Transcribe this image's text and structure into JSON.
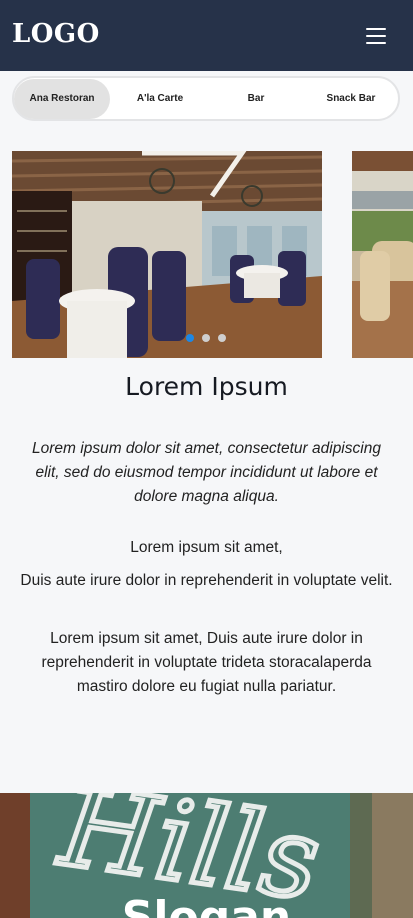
{
  "header": {
    "logo": "LOGO",
    "menu_icon": "hamburger-menu-icon"
  },
  "tabs": [
    {
      "label": "Ana Restoran",
      "active": true
    },
    {
      "label": "A'la Carte",
      "active": false
    },
    {
      "label": "Bar",
      "active": false
    },
    {
      "label": "Snack Bar",
      "active": false
    }
  ],
  "carousel": {
    "slides": [
      "restaurant-dining-room-photo",
      "terrace-chairs-photo"
    ],
    "slide_count": 3,
    "active_slide": 1,
    "active_dot_color": "#1e88e5",
    "inactive_dot_color": "#cfcfcf"
  },
  "content": {
    "title": "Lorem Ipsum",
    "lead": "Lorem ipsum dolor sit amet, consectetur adipiscing elit, sed do eiusmod tempor incididunt ut labore et dolore magna aliqua.",
    "paragraphs": [
      "Lorem ipsum sit amet,",
      "Duis aute irure dolor in reprehenderit in voluptate velit.",
      "Lorem ipsum sit amet, Duis aute irure dolor in reprehenderit in voluptate trideta storacalaperda mastiro dolore eu fugiat nulla pariatur."
    ]
  },
  "hero": {
    "image": "hills-signage-photo",
    "sign_text": "Hills",
    "slogan": "Slogan"
  },
  "colors": {
    "header_bg": "#263249",
    "page_bg": "#f6f7f9",
    "tab_active_bg": "#e2e2e2"
  }
}
